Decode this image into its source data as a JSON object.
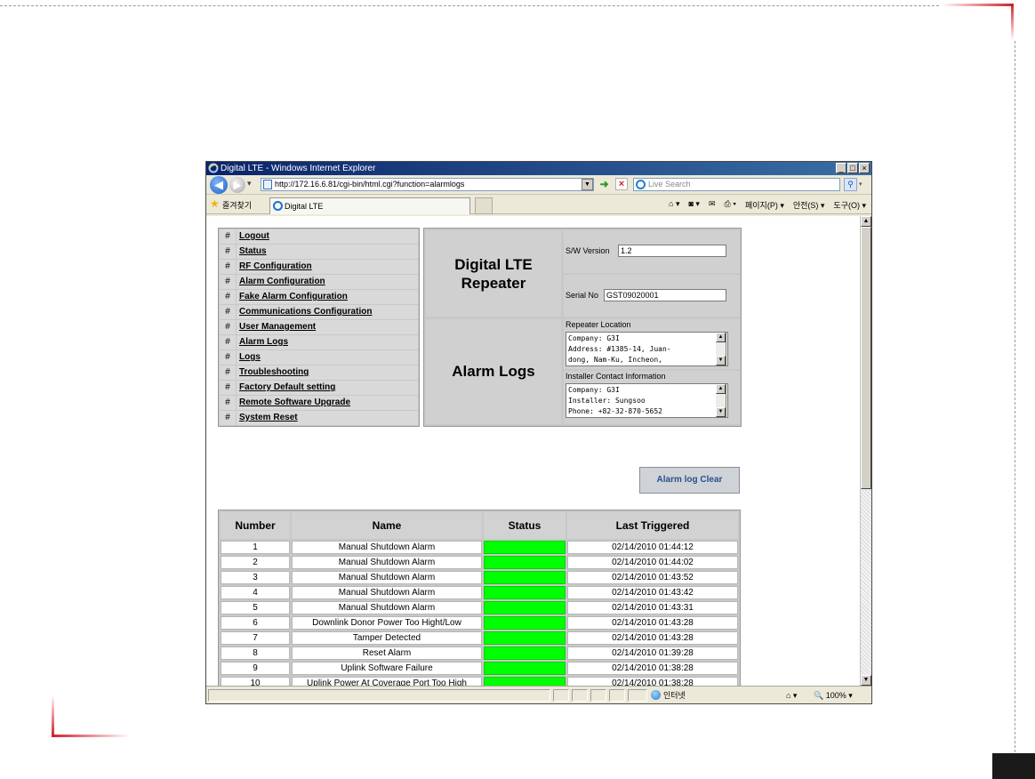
{
  "browser": {
    "title": "Digital LTE - Windows Internet Explorer",
    "url": "http://172.16.6.81/cgi-bin/html.cgi?function=alarmlogs",
    "search_placeholder": "Live Search",
    "favorites_label": "즐겨찾기",
    "tab_label": "Digital LTE",
    "commands": [
      "페이지(P) ▾",
      "안전(S) ▾",
      "도구(O) ▾"
    ],
    "status_zone": "인터넷",
    "zoom": "100%"
  },
  "menu": {
    "hash": "#",
    "items": [
      "Logout",
      "Status",
      "RF Configuration",
      "Alarm Configuration",
      "Fake Alarm Configuration",
      "Communications Configuration",
      "User Management",
      "Alarm Logs",
      "Logs",
      "Troubleshooting",
      "Factory Default setting",
      "Remote Software Upgrade",
      "System Reset"
    ]
  },
  "header": {
    "title": "Digital LTE\nRepeater",
    "page_title": "Alarm Logs",
    "sw_version_label": "S/W Version",
    "sw_version": "1.2",
    "serial_label": "Serial No",
    "serial": "GST09020001",
    "location_label": "Repeater Location",
    "location_lines": [
      "Company: G3I",
      "Address: #1385-14, Juan-",
      "dong, Nam-Ku, Incheon,"
    ],
    "installer_label": "Installer Contact Information",
    "installer_lines": [
      "Company: G3I",
      "Installer: Sungsoo",
      "Phone: +82-32-870-5652"
    ]
  },
  "clear_button": "Alarm log Clear",
  "alarm_table": {
    "columns": [
      "Number",
      "Name",
      "Status",
      "Last Triggered"
    ],
    "status_color": "#00ff00",
    "rows": [
      {
        "number": "1",
        "name": "Manual Shutdown Alarm",
        "time": "02/14/2010 01:44:12"
      },
      {
        "number": "2",
        "name": "Manual Shutdown Alarm",
        "time": "02/14/2010 01:44:02"
      },
      {
        "number": "3",
        "name": "Manual Shutdown Alarm",
        "time": "02/14/2010 01:43:52"
      },
      {
        "number": "4",
        "name": "Manual Shutdown Alarm",
        "time": "02/14/2010 01:43:42"
      },
      {
        "number": "5",
        "name": "Manual Shutdown Alarm",
        "time": "02/14/2010 01:43:31"
      },
      {
        "number": "6",
        "name": "Downlink Donor Power Too Hight/Low",
        "time": "02/14/2010 01:43:28"
      },
      {
        "number": "7",
        "name": "Tamper Detected",
        "time": "02/14/2010 01:43:28"
      },
      {
        "number": "8",
        "name": "Reset Alarm",
        "time": "02/14/2010 01:39:28"
      },
      {
        "number": "9",
        "name": "Uplink Software Failure",
        "time": "02/14/2010 01:38:28"
      },
      {
        "number": "10",
        "name": "Uplink Power At Coverage Port Too High",
        "time": "02/14/2010 01:38:28"
      }
    ]
  }
}
